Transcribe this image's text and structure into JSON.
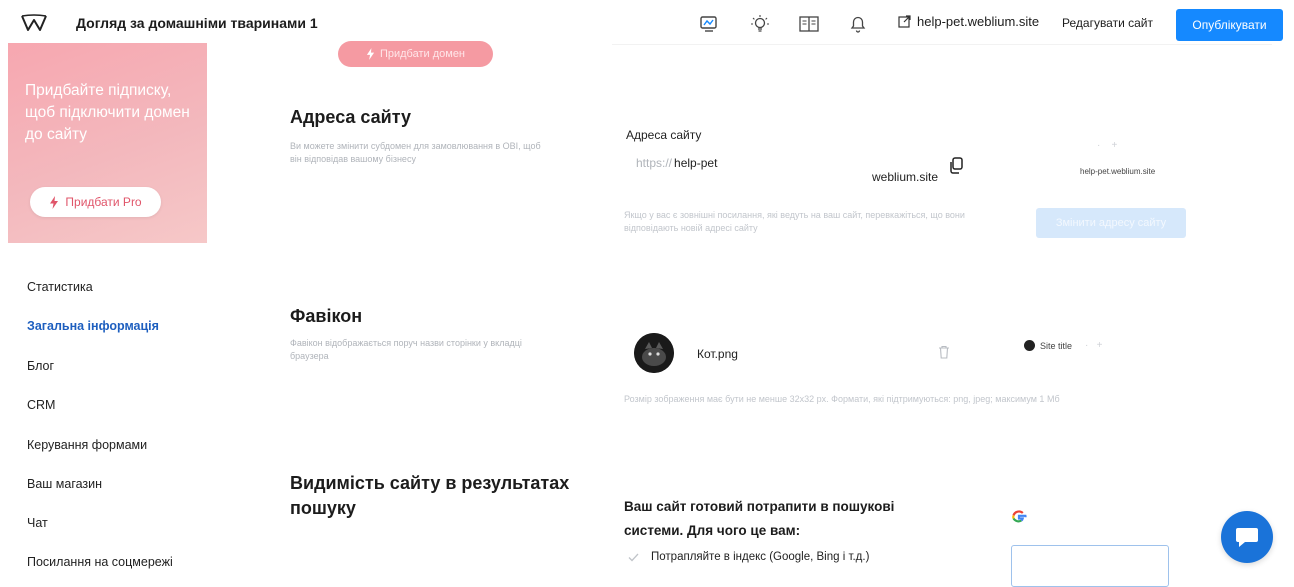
{
  "topbar": {
    "site_name": "Догляд за домашніми тваринами 1",
    "domain_link": "help-pet.weblium.site",
    "edit_label": "Редагувати сайт",
    "publish_label": "Опублікувати",
    "icons": [
      "monitor-icon",
      "lightbulb-icon",
      "book-icon",
      "bell-icon",
      "external-link-icon"
    ]
  },
  "promo": {
    "text": "Придбайте підписку, щоб підключити домен до сайту",
    "button_label": "Придбати Pro"
  },
  "sidebar": {
    "items": [
      {
        "label": "Статистика",
        "active": false
      },
      {
        "label": "Загальна інформація",
        "active": true
      },
      {
        "label": "Блог",
        "active": false
      },
      {
        "label": "CRM",
        "active": false
      },
      {
        "label": "Керування формами",
        "active": false
      },
      {
        "label": "Ваш магазин",
        "active": false
      },
      {
        "label": "Чат",
        "active": false
      },
      {
        "label": "Посилання на соцмережі",
        "active": false
      }
    ]
  },
  "main": {
    "add_domain_label": "Придбати домен",
    "address": {
      "title": "Адреса сайту",
      "description": "Ви можете змінити субдомен для замовлювання в OBI, щоб він відповідав вашому бізнесу",
      "field_label": "Адреса сайту",
      "prefix": "https://",
      "subdomain": "help-pet",
      "suffix": "weblium.site",
      "preview_url": "help-pet.weblium.site",
      "hint": "Якщо у вас є зовнішні посилання, які ведуть на ваш сайт, перевкажіться, що вони відповідають новій адресі сайту",
      "change_button": "Змінити адресу сайту"
    },
    "favicon": {
      "title": "Фавікон",
      "description": "Фавікон відображається поруч назви сторінки у вкладці браузера",
      "file_name": "Кот.png",
      "tab_title": "Site title",
      "hint": "Розмір зображення має бути не менше 32x32 px. Формати, які підтримуються: png, jpeg; максимум 1 Мб"
    },
    "seo": {
      "title": "Видимість сайту в результатах пошуку",
      "ready_text": "Ваш сайт готовий потрапити в пошукові системи. Для чого це вам:",
      "bullet_1": "Потрапляйте в індекс (Google, Bing і т.д.)"
    }
  },
  "colors": {
    "accent": "#1589ff",
    "active_nav": "#1e5fbf",
    "promo_pink": "#f4a9b1",
    "chat_blue": "#1a73d9"
  }
}
